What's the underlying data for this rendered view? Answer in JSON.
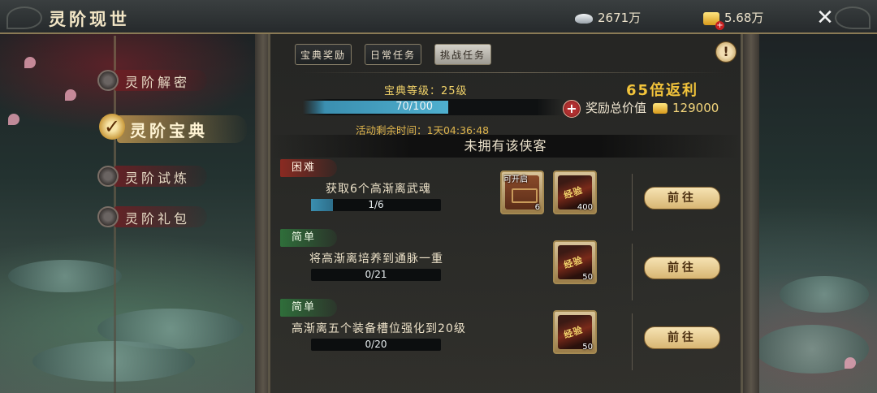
{
  "header": {
    "title": "灵阶现世",
    "silver": "2671万",
    "gold": "5.68万"
  },
  "nav": [
    {
      "label": "灵阶解密"
    },
    {
      "label": "灵阶宝典"
    },
    {
      "label": "灵阶试炼"
    },
    {
      "label": "灵阶礼包"
    }
  ],
  "tabs": [
    {
      "label": "宝典奖励"
    },
    {
      "label": "日常任务"
    },
    {
      "label": "挑战任务"
    }
  ],
  "book": {
    "level_label": "宝典等级：25级",
    "xp_text": "70/100",
    "xp_fraction": 0.7,
    "time_label": "活动剩余时间：1天04:36:48",
    "multiplier_num": "65",
    "multiplier_text": "倍返利",
    "reward_label": "奖励总价值",
    "reward_amount": "129000"
  },
  "notice": "未拥有该侠客",
  "tasks": [
    {
      "difficulty": "困难",
      "name": "获取6个高渐离武魂",
      "progress_text": "1/6",
      "progress_fraction": 0.1667,
      "rewards": [
        {
          "icon": "chest-icon",
          "tag": "可开启",
          "count": "6"
        },
        {
          "icon": "exp-scroll-icon",
          "count": "400"
        }
      ],
      "button": "前往"
    },
    {
      "difficulty": "简单",
      "name": "将高渐离培养到通脉一重",
      "progress_text": "0/21",
      "progress_fraction": 0,
      "rewards": [
        {
          "icon": "exp-scroll-icon",
          "count": "50"
        }
      ],
      "button": "前往"
    },
    {
      "difficulty": "简单",
      "name": "高渐离五个装备槽位强化到20级",
      "progress_text": "0/20",
      "progress_fraction": 0,
      "rewards": [
        {
          "icon": "exp-scroll-icon",
          "count": "50"
        }
      ],
      "button": "前往"
    }
  ]
}
